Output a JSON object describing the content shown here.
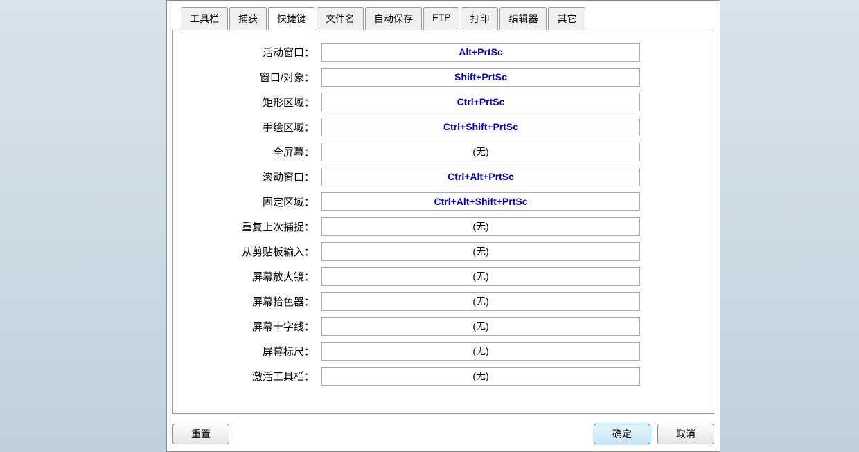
{
  "tabs": [
    {
      "label": "工具栏"
    },
    {
      "label": "捕获"
    },
    {
      "label": "快捷键"
    },
    {
      "label": "文件名"
    },
    {
      "label": "自动保存"
    },
    {
      "label": "FTP"
    },
    {
      "label": "打印"
    },
    {
      "label": "编辑器"
    },
    {
      "label": "其它"
    }
  ],
  "activeTab": 2,
  "hotkeys": [
    {
      "label": "活动窗口：",
      "value": "Alt+PrtSc",
      "isSet": true
    },
    {
      "label": "窗口/对象：",
      "value": "Shift+PrtSc",
      "isSet": true
    },
    {
      "label": "矩形区域：",
      "value": "Ctrl+PrtSc",
      "isSet": true
    },
    {
      "label": "手绘区域：",
      "value": "Ctrl+Shift+PrtSc",
      "isSet": true
    },
    {
      "label": "全屏幕：",
      "value": "(无)",
      "isSet": false
    },
    {
      "label": "滚动窗口：",
      "value": "Ctrl+Alt+PrtSc",
      "isSet": true
    },
    {
      "label": "固定区域：",
      "value": "Ctrl+Alt+Shift+PrtSc",
      "isSet": true
    },
    {
      "label": "重复上次捕捉：",
      "value": "(无)",
      "isSet": false
    },
    {
      "label": "从剪贴板输入：",
      "value": "(无)",
      "isSet": false
    },
    {
      "label": "屏幕放大镜：",
      "value": "(无)",
      "isSet": false
    },
    {
      "label": "屏幕拾色器：",
      "value": "(无)",
      "isSet": false
    },
    {
      "label": "屏幕十字线：",
      "value": "(无)",
      "isSet": false
    },
    {
      "label": "屏幕标尺：",
      "value": "(无)",
      "isSet": false
    },
    {
      "label": "激活工具栏：",
      "value": "(无)",
      "isSet": false
    }
  ],
  "buttons": {
    "reset": "重置",
    "ok": "确定",
    "cancel": "取消"
  }
}
